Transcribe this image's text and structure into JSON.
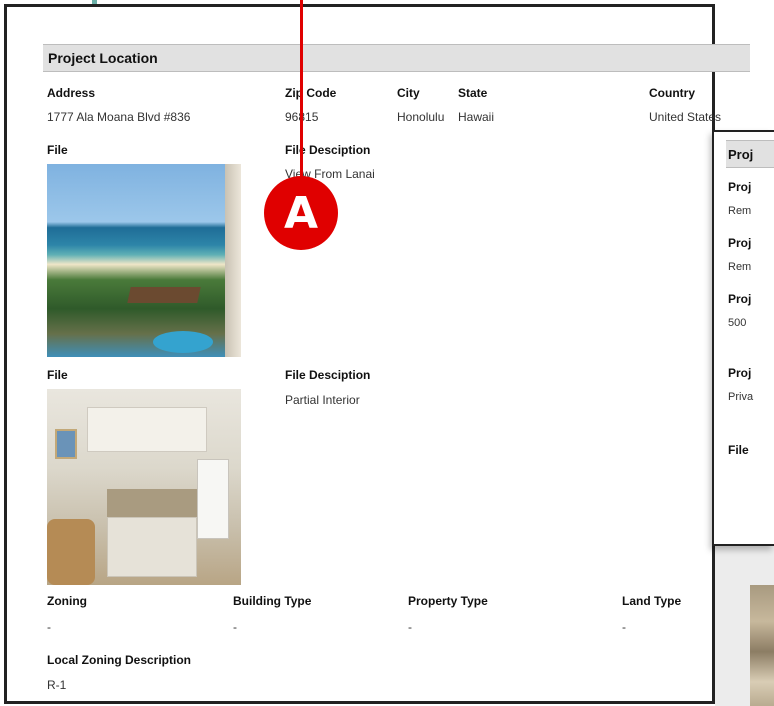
{
  "section": {
    "title": "Project Location"
  },
  "location": {
    "headers": {
      "address": "Address",
      "zip": "Zip Code",
      "city": "City",
      "state": "State",
      "country": "Country"
    },
    "values": {
      "address": "1777 Ala Moana Blvd #836",
      "zip": "96815",
      "city": "Honolulu",
      "state": "Hawaii",
      "country": "United States"
    }
  },
  "files": [
    {
      "file_label": "File",
      "desc_label": "File Desciption",
      "description": "View From Lanai"
    },
    {
      "file_label": "File",
      "desc_label": "File Desciption",
      "description": "Partial Interior"
    }
  ],
  "zoning": {
    "headers": {
      "zoning": "Zoning",
      "building_type": "Building Type",
      "property_type": "Property Type",
      "land_type": "Land Type"
    },
    "values": {
      "zoning": "-",
      "building_type": "-",
      "property_type": "-",
      "land_type": "-"
    },
    "local_label": "Local Zoning Description",
    "local_value": "R-1"
  },
  "side_doc": {
    "title": "Proj",
    "rows": [
      {
        "label": "Proj",
        "value": "Rem"
      },
      {
        "label": "Proj",
        "value": "Rem"
      },
      {
        "label": "Proj",
        "value": "500"
      },
      {
        "label": "Proj",
        "value": "Priva"
      },
      {
        "label": "File",
        "value": ""
      }
    ]
  },
  "callout": {
    "letter": "A",
    "color": "#e00000"
  }
}
